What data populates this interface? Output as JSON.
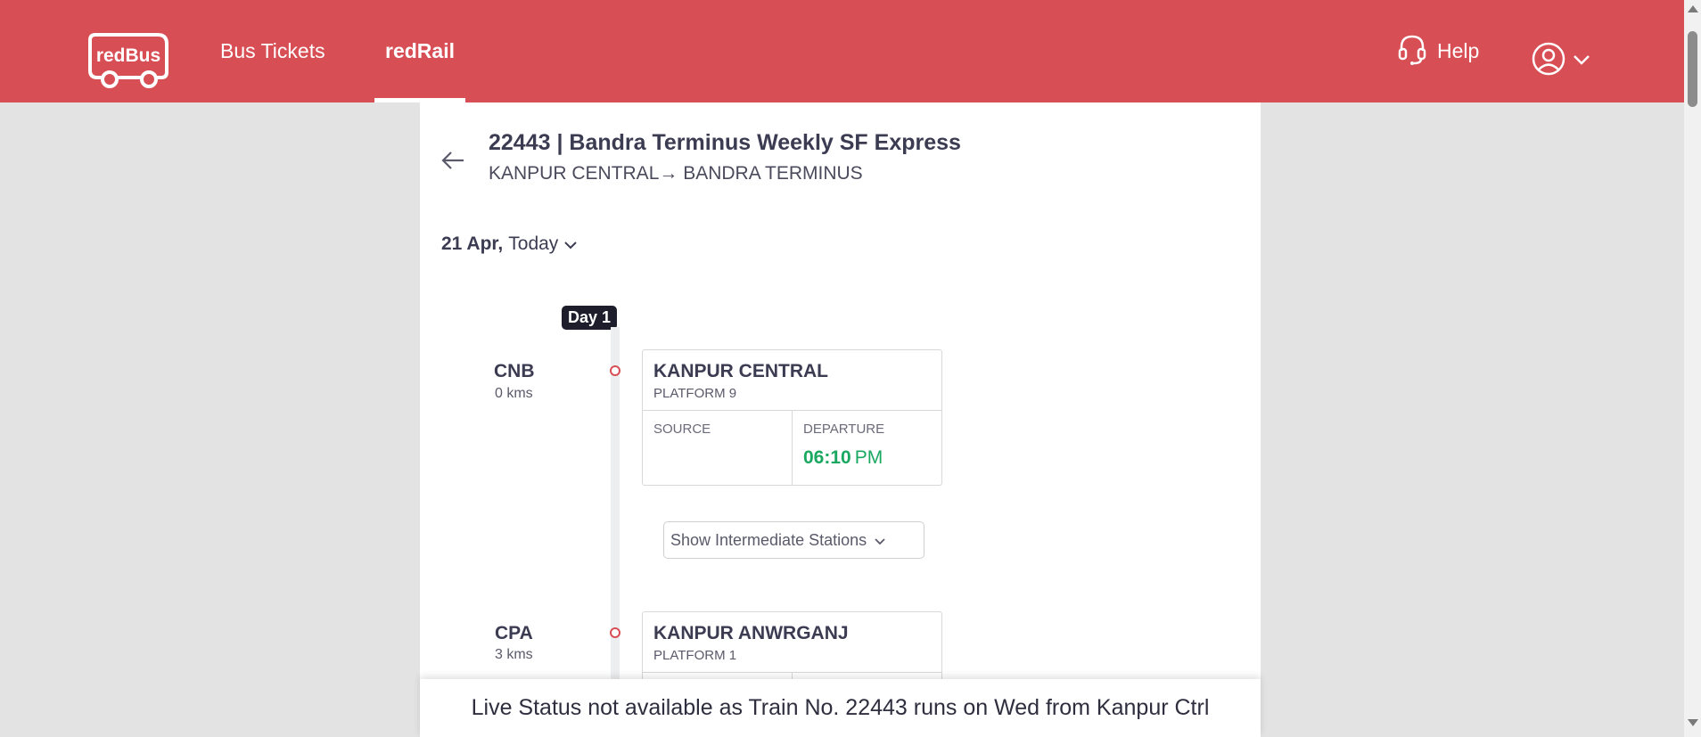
{
  "header": {
    "brand": "redBus",
    "nav": {
      "bus_tickets": "Bus Tickets",
      "red_rail": "redRail"
    },
    "help_label": "Help",
    "colors": {
      "brand": "#d84e55"
    },
    "icons": {
      "help": "headset-icon",
      "account": "user-circle-icon",
      "account_menu": "chevron-down-icon"
    }
  },
  "train": {
    "title": "22443 | Bandra Terminus Weekly SF Express",
    "route": "KANPUR CENTRAL→  BANDRA TERMINUS"
  },
  "date": {
    "day": "21 Apr,",
    "label": "Today"
  },
  "timeline": {
    "day_badge": "Day 1",
    "stations": [
      {
        "code": "CNB",
        "distance": "0 kms",
        "name": "KANPUR CENTRAL",
        "platform": "PLATFORM 9",
        "left_label": "SOURCE",
        "right_label": "DEPARTURE",
        "time": "06:10",
        "ampm": "PM"
      },
      {
        "code": "CPA",
        "distance": "3 kms",
        "name": "KANPUR ANWRGANJ",
        "platform": "PLATFORM 1"
      }
    ],
    "show_intermediate": "Show Intermediate Stations"
  },
  "status_bar": {
    "message": "Live Status not available as Train No. 22443 runs on Wed from Kanpur Ctrl"
  }
}
